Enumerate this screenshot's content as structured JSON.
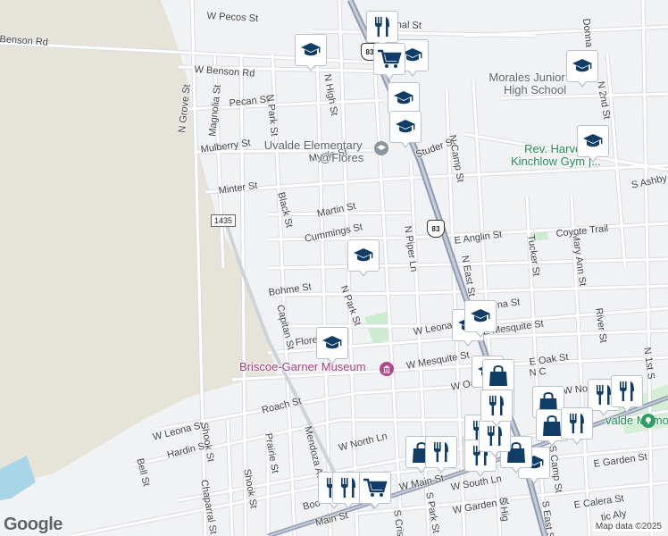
{
  "colors": {
    "land": "#f1f2f4",
    "open_area": "#e8e6dc",
    "park": "#cdeccf",
    "water": "#a7d6e7",
    "road": "#ffffff",
    "road_outline": "#d5d8dc",
    "highway": "#8f9bb0",
    "marker_icon": "#0f3d66"
  },
  "streets": [
    {
      "text": "W Pecos St"
    },
    {
      "text": "Benson Rd"
    },
    {
      "text": "W Benson Rd"
    },
    {
      "text": "N Grove St"
    },
    {
      "text": "Magnolia St"
    },
    {
      "text": "Pecan St"
    },
    {
      "text": "N Park St"
    },
    {
      "text": "N High St"
    },
    {
      "text": "Mulberry St"
    },
    {
      "text": "Myrtle St"
    },
    {
      "text": "Minter St"
    },
    {
      "text": "Black St"
    },
    {
      "text": "Martin St"
    },
    {
      "text": "Cummings St"
    },
    {
      "text": "Bohme St"
    },
    {
      "text": "Capitan St"
    },
    {
      "text": "N Park St"
    },
    {
      "text": "Flores"
    },
    {
      "text": "Studer St"
    },
    {
      "text": "N Camp St"
    },
    {
      "text": "N Piper Ln"
    },
    {
      "text": "E Anglin St"
    },
    {
      "text": "N East St"
    },
    {
      "text": "Tucker St"
    },
    {
      "text": "Mary Ann St"
    },
    {
      "text": "Coyote Trail"
    },
    {
      "text": "S Ashby"
    },
    {
      "text": "Donna"
    },
    {
      "text": "N 2nd St"
    },
    {
      "text": "W Leona St"
    },
    {
      "text": "E Mesquite St"
    },
    {
      "text": "W Mesquite St"
    },
    {
      "text": "River St"
    },
    {
      "text": "N 1st S"
    },
    {
      "text": "E Oak St"
    },
    {
      "text": "W Oak St"
    },
    {
      "text": "W Nopal"
    },
    {
      "text": "Roach St"
    },
    {
      "text": "W Leona St"
    },
    {
      "text": "Hardin St"
    },
    {
      "text": "Bell St"
    },
    {
      "text": "Shook St"
    },
    {
      "text": "Prairie St"
    },
    {
      "text": "Mendoza Ave"
    },
    {
      "text": "Chaparral St"
    },
    {
      "text": "Shook St"
    },
    {
      "text": "W North Ln"
    },
    {
      "text": "W Main St"
    },
    {
      "text": "W South Ln"
    },
    {
      "text": "W Garden St"
    },
    {
      "text": "E Garden St"
    },
    {
      "text": "E Calera St"
    },
    {
      "text": "S Park St"
    },
    {
      "text": "S Camp St"
    },
    {
      "text": "S East S"
    },
    {
      "text": "Main St"
    },
    {
      "text": "Boo"
    },
    {
      "text": "N C"
    },
    {
      "text": "S Cris"
    },
    {
      "text": "S Hig"
    },
    {
      "text": "na St"
    },
    {
      "text": "tic Aly"
    },
    {
      "text": "nal St"
    }
  ],
  "route_shields": {
    "us83": "83",
    "fm1435": "1435"
  },
  "places": {
    "morales_line1": "Morales Junior",
    "morales_line2": "High School",
    "uvalde_line1": "Uvalde Elementary",
    "uvalde_line2": "@Flores",
    "kinchlow_line1": "Rev. Harvey",
    "kinchlow_line2": "Kinchlow Gym |...",
    "museum": "Briscoe-Garner Museum",
    "park": "Uvalde Memorial Park",
    "park_visible": "valde Memorial Park"
  },
  "markers": [
    {
      "icon": "graduation-cap-icon"
    },
    {
      "icon": "graduation-cap-icon"
    },
    {
      "icon": "graduation-cap-icon"
    },
    {
      "icon": "graduation-cap-icon"
    },
    {
      "icon": "graduation-cap-icon"
    },
    {
      "icon": "graduation-cap-icon"
    },
    {
      "icon": "graduation-cap-icon"
    },
    {
      "icon": "graduation-cap-icon"
    },
    {
      "icon": "graduation-cap-icon"
    },
    {
      "icon": "graduation-cap-icon"
    },
    {
      "icon": "graduation-cap-icon"
    },
    {
      "icon": "graduation-cap-icon"
    },
    {
      "icon": "fork-knife-icon"
    },
    {
      "icon": "shopping-cart-icon"
    },
    {
      "icon": "fork-knife-icon"
    },
    {
      "icon": "shopping-bag-icon"
    },
    {
      "icon": "shopping-bag-icon"
    },
    {
      "icon": "shopping-bag-icon"
    },
    {
      "icon": "shopping-bag-icon"
    },
    {
      "icon": "fork-knife-icon"
    },
    {
      "icon": "shopping-cart-icon"
    },
    {
      "icon": "shopping-bag-icon"
    },
    {
      "icon": "fork-knife-icon"
    },
    {
      "icon": "fork-knife-icon"
    },
    {
      "icon": "shopping-bag-icon"
    },
    {
      "icon": "fork-knife-icon"
    },
    {
      "icon": "fork-knife-icon"
    },
    {
      "icon": "fork-knife-icon"
    },
    {
      "icon": "fork-knife-icon"
    },
    {
      "icon": "fork-knife-icon"
    },
    {
      "icon": "fork-knife-icon"
    },
    {
      "icon": "shopping-cart-icon"
    },
    {
      "icon": "fork-knife-icon"
    }
  ],
  "google_logo": "Google",
  "attribution": "Map data ©2025"
}
